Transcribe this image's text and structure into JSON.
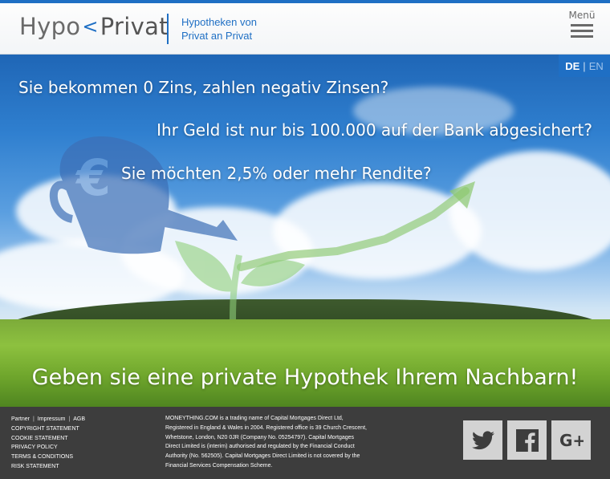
{
  "header": {
    "logo_left": "Hypo",
    "logo_mid": "<",
    "logo_right": "Privat",
    "tagline_line1": "Hypotheken von",
    "tagline_line2": "Privat an Privat",
    "menu_label": "Menü"
  },
  "language": {
    "active": "DE",
    "separator": "|",
    "other": "EN"
  },
  "hero": {
    "line1": "Sie bekommen 0 Zins, zahlen negativ Zinsen?",
    "line2": "Ihr Geld ist nur bis 100.000 auf der Bank abgesichert?",
    "line3": "Sie möchten 2,5% oder mehr Rendite?",
    "cta": "Geben sie eine private Hypothek Ihrem Nachbarn!"
  },
  "footer": {
    "links_row1": [
      "Partner",
      "Impressum",
      "AGB"
    ],
    "link_copyright": "COPYRIGHT STATEMENT",
    "link_cookie": "COOKIE STATEMENT",
    "link_privacy": "PRIVACY POLICY",
    "link_terms": "TERMS & CONDITIONS",
    "link_risk": "RISK STATEMENT",
    "legal_lines": [
      "MONEYTHING.COM is a trading name of Capital Mortgages Direct Ltd,",
      "Registered in England & Wales in 2004. Registered office is 39 Church Crescent,",
      "Whetstone, London, N20 0JR (Company No. 05254797). Capital Mortgages",
      "Direct Limited is (interim) authorised and regulated by the Financial Conduct",
      "Authority (No. 562505). Capital Mortgages Direct Limited is not covered by the",
      "Financial Services Compensation Scheme."
    ]
  },
  "icons": {
    "social": [
      "twitter-icon",
      "facebook-icon",
      "google-plus-icon"
    ],
    "social_bg": "#d3d3d3",
    "social_fg": "#3d3d3d"
  },
  "colors": {
    "brand_blue": "#1f6fc4",
    "footer_bg": "#3d3d3d"
  }
}
